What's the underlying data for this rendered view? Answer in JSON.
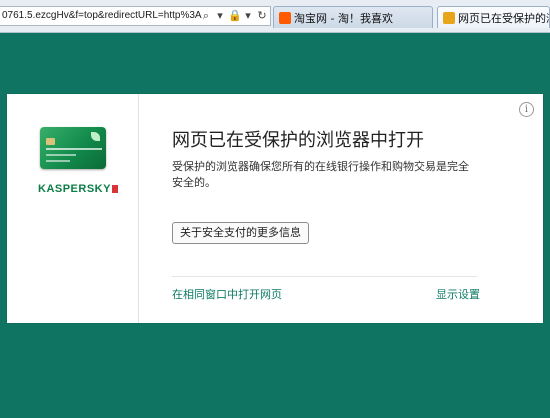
{
  "browser": {
    "address": "0761.5.ezcgHv&f=top&redirectURL=http%3A",
    "tabs": [
      {
        "label": "淘宝网 - 淘！我喜欢",
        "favicon_color": "#ff5a00"
      },
      {
        "label": "网页已在受保护的浏览器中打开",
        "favicon_color": "#e8a51a"
      }
    ]
  },
  "dialog": {
    "brand": "KASPERSKY",
    "title": "网页已在受保护的浏览器中打开",
    "description": "受保护的浏览器确保您所有的在线银行操作和购物交易是完全安全的。",
    "more_info_button": "关于安全支付的更多信息",
    "open_in_same_window_link": "在相同窗口中打开网页",
    "show_settings_link": "显示设置"
  },
  "colors": {
    "background": "#0f7462",
    "link": "#0f7a66",
    "brand_green": "#0d7e46"
  }
}
